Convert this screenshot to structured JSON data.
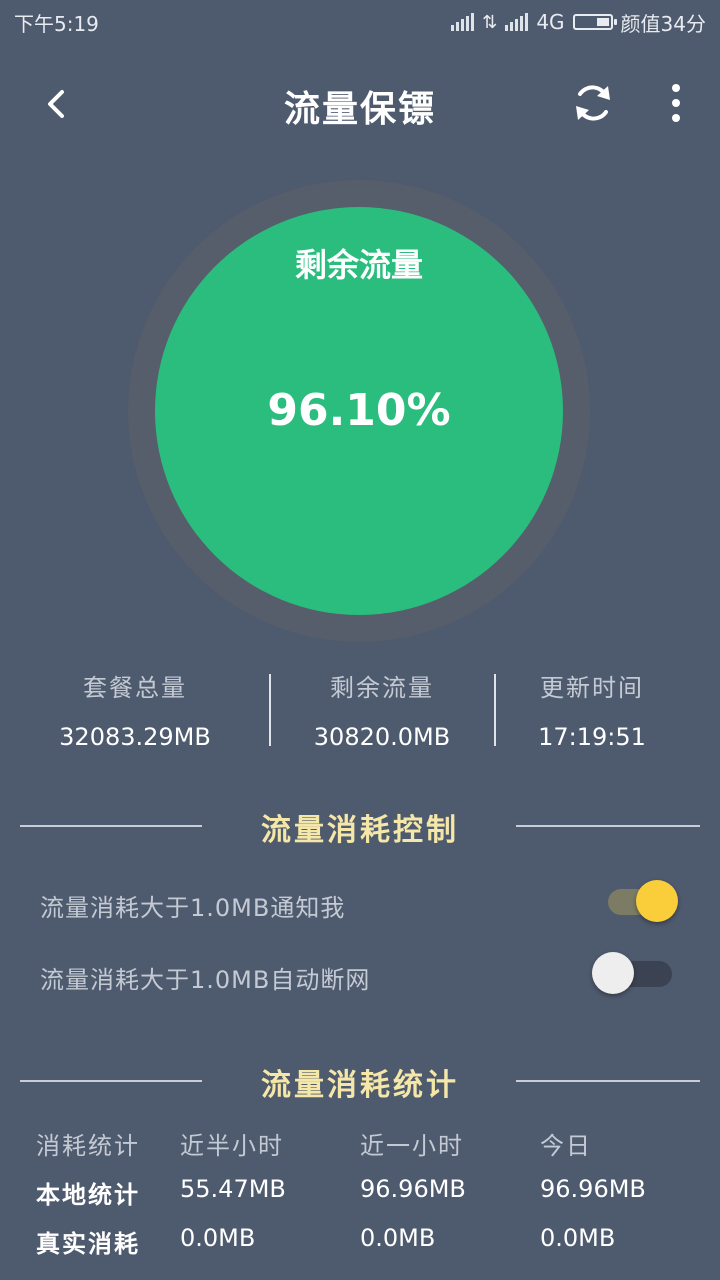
{
  "status_bar": {
    "time": "下午5:19",
    "network": "4G",
    "battery_text": "颜值34分"
  },
  "header": {
    "title": "流量保镖"
  },
  "gauge": {
    "label": "剩余流量",
    "percent_text": "96.10%",
    "remaining_fraction": 0.961,
    "fill_color": "#2bbd7e"
  },
  "stats": [
    {
      "label": "套餐总量",
      "value": "32083.29MB"
    },
    {
      "label": "剩余流量",
      "value": "30820.0MB"
    },
    {
      "label": "更新时间",
      "value": "17:19:51"
    }
  ],
  "control": {
    "title": "流量消耗控制",
    "toggles": [
      {
        "label": "流量消耗大于1.0MB通知我",
        "on": true
      },
      {
        "label": "流量消耗大于1.0MB自动断网",
        "on": false
      }
    ]
  },
  "statistics": {
    "title": "流量消耗统计",
    "headers": [
      "消耗统计",
      "近半小时",
      "近一小时",
      "今日"
    ],
    "rows": [
      [
        "本地统计",
        "55.47MB",
        "96.96MB",
        "96.96MB"
      ],
      [
        "真实消耗",
        "0.0MB",
        "0.0MB",
        "0.0MB"
      ]
    ]
  },
  "colors": {
    "background": "#4e5a6d",
    "accent_yellow": "#f9ce3a",
    "section_title": "#f5e7a8"
  }
}
